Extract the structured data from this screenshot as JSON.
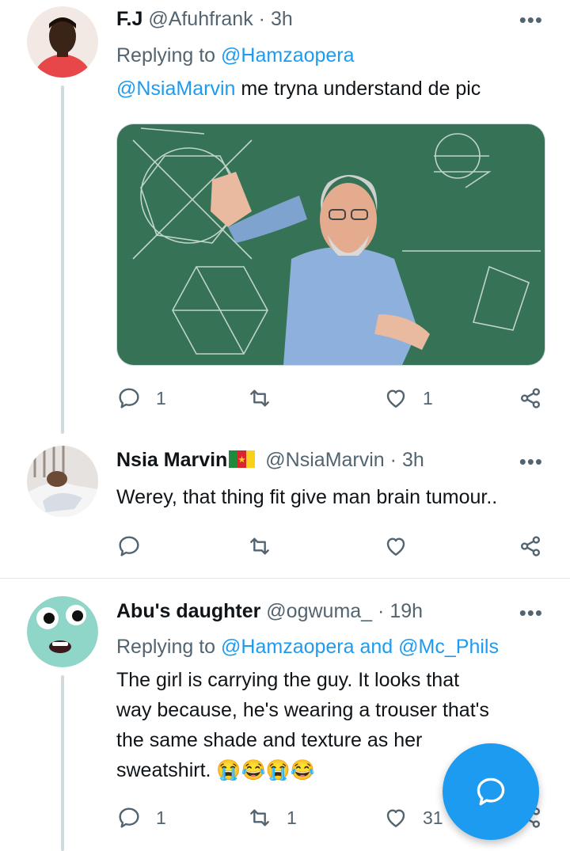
{
  "tweets": [
    {
      "name": "F.J",
      "handle": "@Afuhfrank",
      "dot": "·",
      "time": "3h",
      "replying_prefix": "Replying to ",
      "replying_to": "@Hamzaopera",
      "mention": "@NsiaMarvin",
      "text": " me tryna understand de pic",
      "media_icon": "professor-chalkboard-image",
      "reply_count": "1",
      "retweet_count": "",
      "like_count": "1"
    },
    {
      "name": "Nsia Marvin",
      "flag_icon": "cameroon-flag-icon",
      "handle": "@NsiaMarvin",
      "dot": "·",
      "time": "3h",
      "text": "Werey, that thing fit give man brain tumour..",
      "reply_count": "",
      "retweet_count": "",
      "like_count": ""
    },
    {
      "name": "Abu's daughter",
      "handle": "@ogwuma_",
      "dot": "·",
      "time": "19h",
      "replying_prefix": "Replying to ",
      "replying_to_1": "@Hamzaopera",
      "replying_and": " and ",
      "replying_to_2": "@Mc_Phils",
      "text_lines": [
        "The girl is carrying the guy. It looks that",
        "way because, he's wearing a trouser that's",
        "the same shade and texture as her",
        "sweatshirt. 😭😂😭😂"
      ],
      "reply_count": "1",
      "retweet_count": "1",
      "like_count": "31"
    }
  ],
  "more_label": "•••",
  "colors": {
    "accent": "#1d9bf0",
    "muted": "#536471",
    "text": "#0f1419",
    "line": "#cfd9de"
  }
}
